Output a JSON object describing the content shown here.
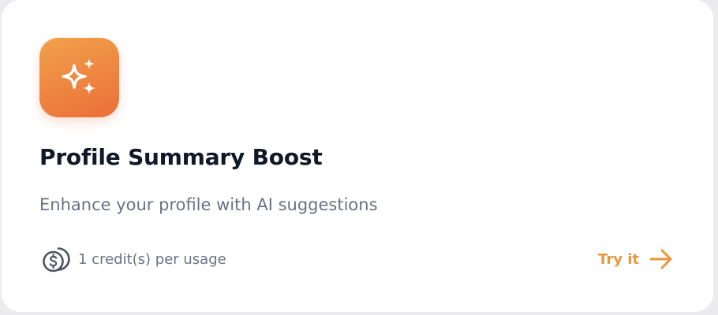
{
  "card": {
    "title": "Profile Summary Boost",
    "description": "Enhance your profile with AI suggestions",
    "icon": "sparkles-icon",
    "credits_icon": "coins-icon",
    "credits_text": "1 credit(s) per usage",
    "action_label": "Try it",
    "action_icon": "arrow-right-icon"
  },
  "colors": {
    "icon_gradient_start": "#f0a24a",
    "icon_gradient_end": "#ec6e3a",
    "accent": "#e8973b",
    "title": "#111827",
    "muted": "#6b7280",
    "background": "#ffffff"
  }
}
